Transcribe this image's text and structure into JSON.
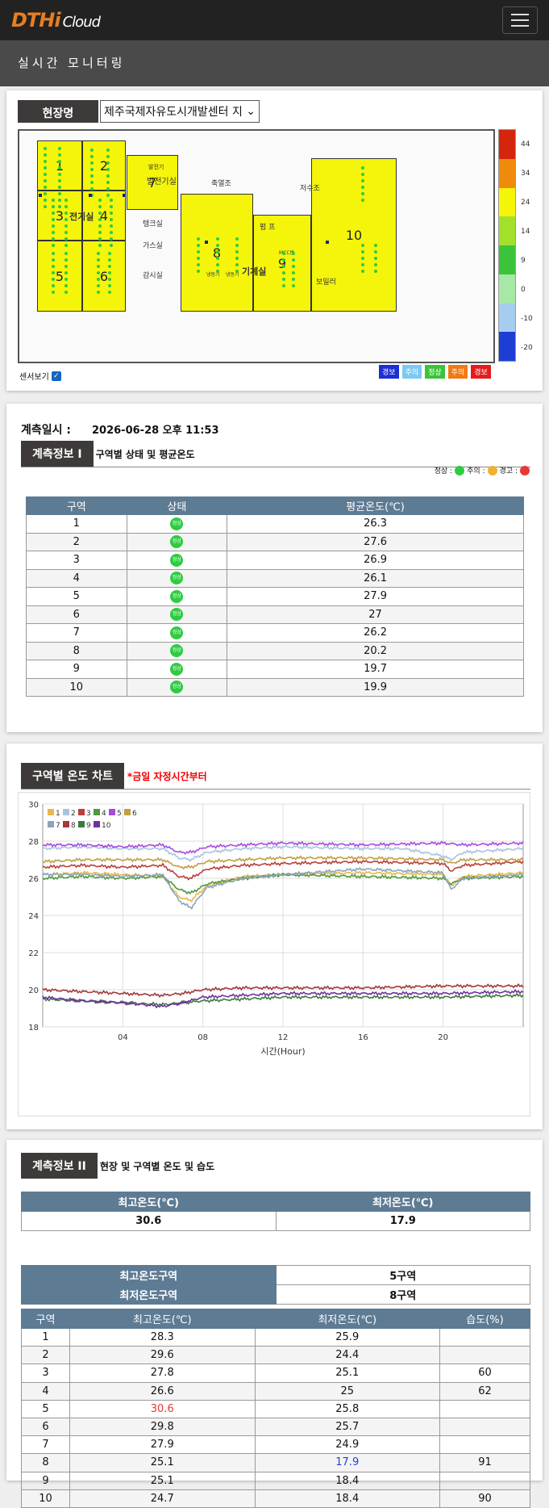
{
  "header": {
    "logo_text": "DTHi",
    "logo_sub": "Cloud",
    "menu_icon": "hamburger-icon"
  },
  "subheader": {
    "title": "실시간 모니터링"
  },
  "site": {
    "label": "현장명",
    "selected": "제주국제자유도시개발센터 지",
    "zones": [
      {
        "id": "1",
        "label": "1"
      },
      {
        "id": "2",
        "label": "2"
      },
      {
        "id": "3",
        "label": "3"
      },
      {
        "id": "4",
        "label": "4"
      },
      {
        "id": "5",
        "label": "5"
      },
      {
        "id": "6",
        "label": "6"
      },
      {
        "id": "7",
        "label": "7"
      },
      {
        "id": "8",
        "label": "8"
      },
      {
        "id": "9",
        "label": "9"
      },
      {
        "id": "10",
        "label": "10"
      }
    ],
    "rooms": {
      "r1": "전기실",
      "r2": "발전기실",
      "r3": "발전기",
      "r4": "축열조",
      "r5": "저수조",
      "r6": "탱크실",
      "r7": "가스실",
      "r8": "감시실",
      "r9": "펌 프",
      "r10": "기계실",
      "r11": "MCC반",
      "r12": "보일러",
      "r13": "냉동기",
      "r14": "냉동기"
    },
    "colorbar": [
      {
        "label": "44",
        "color": "#d4260c"
      },
      {
        "label": "34",
        "color": "#f08a0a"
      },
      {
        "label": "24",
        "color": "#f5f50a"
      },
      {
        "label": "14",
        "color": "#a3e02c"
      },
      {
        "label": "9",
        "color": "#3bc43b"
      },
      {
        "label": "0",
        "color": "#a6e8a6"
      },
      {
        "label": "-10",
        "color": "#a6ccf0"
      },
      {
        "label": "-20",
        "color": "#1c3ed4"
      }
    ],
    "sensor_toggle": "센서보기",
    "legend": [
      {
        "label": "경보",
        "color": "#1c2ed4"
      },
      {
        "label": "주의",
        "color": "#7cc8f4"
      },
      {
        "label": "정상",
        "color": "#3ac43a"
      },
      {
        "label": "주의",
        "color": "#f07a14"
      },
      {
        "label": "경보",
        "color": "#e41c1c"
      }
    ]
  },
  "info1": {
    "time_label": "계측일시 :",
    "time_value": "2026-06-28 오후 11:53",
    "tab": "계측정보 I",
    "desc": "구역별 상태 및 평균온도",
    "status_legend": {
      "normal": "정상 :",
      "caution": "주의 :",
      "warning": "경고 :"
    },
    "status_icon_text": "정상",
    "headers": [
      "구역",
      "상태",
      "평균온도(℃)"
    ],
    "rows": [
      {
        "zone": "1",
        "avg": "26.3"
      },
      {
        "zone": "2",
        "avg": "27.6"
      },
      {
        "zone": "3",
        "avg": "26.9"
      },
      {
        "zone": "4",
        "avg": "26.1"
      },
      {
        "zone": "5",
        "avg": "27.9"
      },
      {
        "zone": "6",
        "avg": "27"
      },
      {
        "zone": "7",
        "avg": "26.2"
      },
      {
        "zone": "8",
        "avg": "20.2"
      },
      {
        "zone": "9",
        "avg": "19.7"
      },
      {
        "zone": "10",
        "avg": "19.9"
      }
    ]
  },
  "chart_section": {
    "title": "구역별 온도 차트",
    "note": "*금일 자정시간부터"
  },
  "chart_data": {
    "type": "line",
    "xlabel": "시간(Hour)",
    "ylabel": "",
    "xlim": [
      0,
      24
    ],
    "ylim": [
      18,
      30
    ],
    "xticks": [
      "04",
      "08",
      "12",
      "16",
      "20"
    ],
    "xtick_values": [
      4,
      8,
      12,
      16,
      20
    ],
    "yticks": [
      18,
      20,
      22,
      24,
      26,
      28,
      30
    ],
    "grid": true,
    "legend_position": "top-left",
    "series": [
      {
        "name": "1",
        "color": "#e8b84a",
        "x": [
          0,
          2,
          4,
          6,
          6.8,
          7.4,
          8.2,
          10,
          12,
          16,
          20,
          20.4,
          21,
          24
        ],
        "y": [
          26.2,
          26.3,
          26.2,
          26.1,
          25.0,
          24.8,
          25.6,
          26.1,
          26.2,
          26.3,
          26.2,
          25.6,
          26.1,
          26.3
        ]
      },
      {
        "name": "2",
        "color": "#a8c4e0",
        "x": [
          0,
          2,
          4,
          6,
          6.8,
          7.4,
          8.2,
          10,
          12,
          16,
          18,
          19,
          20,
          20.4,
          21,
          24
        ],
        "y": [
          27.6,
          27.7,
          27.6,
          27.6,
          27.1,
          27.0,
          27.4,
          27.6,
          27.7,
          27.6,
          27.6,
          27.4,
          27.2,
          27.0,
          27.4,
          27.6
        ]
      },
      {
        "name": "3",
        "color": "#b8403a",
        "x": [
          0,
          2,
          4,
          6,
          6.8,
          7.4,
          8.2,
          10,
          12,
          16,
          20,
          20.4,
          21,
          24
        ],
        "y": [
          26.6,
          26.7,
          26.6,
          26.7,
          26.1,
          26.0,
          26.5,
          26.7,
          26.8,
          26.9,
          26.8,
          26.4,
          26.7,
          26.9
        ]
      },
      {
        "name": "4",
        "color": "#4c9a3c",
        "x": [
          0,
          2,
          4,
          6,
          6.8,
          7.4,
          8.2,
          10,
          12,
          16,
          20,
          20.4,
          21,
          24
        ],
        "y": [
          26.0,
          26.1,
          26.0,
          26.1,
          25.4,
          25.2,
          25.7,
          26.0,
          26.2,
          26.1,
          26.0,
          25.7,
          26.0,
          26.1
        ]
      },
      {
        "name": "5",
        "color": "#a84ae0",
        "x": [
          0,
          2,
          4,
          6,
          6.8,
          7.4,
          8.2,
          10,
          12,
          16,
          20,
          21,
          24
        ],
        "y": [
          27.8,
          27.8,
          27.7,
          27.8,
          27.4,
          27.4,
          27.7,
          27.8,
          27.9,
          27.8,
          27.9,
          27.8,
          27.9
        ]
      },
      {
        "name": "6",
        "color": "#c0a040",
        "x": [
          0,
          2,
          4,
          6,
          6.8,
          7.4,
          8.2,
          10,
          12,
          16,
          20,
          20.4,
          21,
          24
        ],
        "y": [
          26.9,
          27.0,
          27.0,
          27.0,
          26.6,
          26.6,
          26.9,
          27.0,
          27.1,
          27.1,
          27.0,
          26.8,
          27.0,
          27.0
        ]
      },
      {
        "name": "7",
        "color": "#8aa4bc",
        "x": [
          0,
          2,
          4,
          6,
          6.8,
          7.4,
          8.2,
          10,
          12,
          16,
          20,
          20.4,
          21,
          24
        ],
        "y": [
          26.2,
          26.2,
          26.1,
          26.2,
          24.8,
          24.4,
          25.5,
          26.0,
          26.2,
          26.5,
          26.3,
          25.4,
          26.0,
          26.2
        ]
      },
      {
        "name": "8",
        "color": "#a03a3a",
        "x": [
          0,
          2,
          4,
          6,
          7,
          8,
          10,
          12,
          16,
          20,
          24
        ],
        "y": [
          20.0,
          19.9,
          19.8,
          19.7,
          19.8,
          20.0,
          20.1,
          20.1,
          20.1,
          20.2,
          20.2
        ]
      },
      {
        "name": "9",
        "color": "#3a7c3a",
        "x": [
          0,
          2,
          4,
          6,
          7,
          8,
          10,
          12,
          16,
          20,
          24
        ],
        "y": [
          19.5,
          19.4,
          19.3,
          19.2,
          19.3,
          19.4,
          19.5,
          19.6,
          19.6,
          19.6,
          19.7
        ]
      },
      {
        "name": "10",
        "color": "#7030a0",
        "x": [
          0,
          2,
          4,
          6,
          7,
          8,
          10,
          12,
          16,
          20,
          24
        ],
        "y": [
          19.6,
          19.4,
          19.3,
          19.1,
          19.3,
          19.6,
          19.7,
          19.8,
          19.8,
          19.8,
          19.9
        ]
      }
    ]
  },
  "info2": {
    "tab": "계측정보 II",
    "desc": "현장 및 구역별 온도 및 습도",
    "max_label": "최고온도(℃)",
    "min_label": "최저온도(℃)",
    "max_value": "30.6",
    "min_value": "17.9",
    "max_zone_label": "최고온도구역",
    "max_zone_value": "5구역",
    "min_zone_label": "최저온도구역",
    "min_zone_value": "8구역",
    "headers": [
      "구역",
      "최고온도(℃)",
      "최저온도(℃)",
      "습도(%)"
    ],
    "rows": [
      {
        "zone": "1",
        "max": "28.3",
        "min": "25.9",
        "hum": ""
      },
      {
        "zone": "2",
        "max": "29.6",
        "min": "24.4",
        "hum": ""
      },
      {
        "zone": "3",
        "max": "27.8",
        "min": "25.1",
        "hum": "60"
      },
      {
        "zone": "4",
        "max": "26.6",
        "min": "25",
        "hum": "62"
      },
      {
        "zone": "5",
        "max": "30.6",
        "min": "25.8",
        "hum": ""
      },
      {
        "zone": "6",
        "max": "29.8",
        "min": "25.7",
        "hum": ""
      },
      {
        "zone": "7",
        "max": "27.9",
        "min": "24.9",
        "hum": ""
      },
      {
        "zone": "8",
        "max": "25.1",
        "min": "17.9",
        "hum": "91"
      },
      {
        "zone": "9",
        "max": "25.1",
        "min": "18.4",
        "hum": ""
      },
      {
        "zone": "10",
        "max": "24.7",
        "min": "18.4",
        "hum": "90"
      }
    ]
  }
}
